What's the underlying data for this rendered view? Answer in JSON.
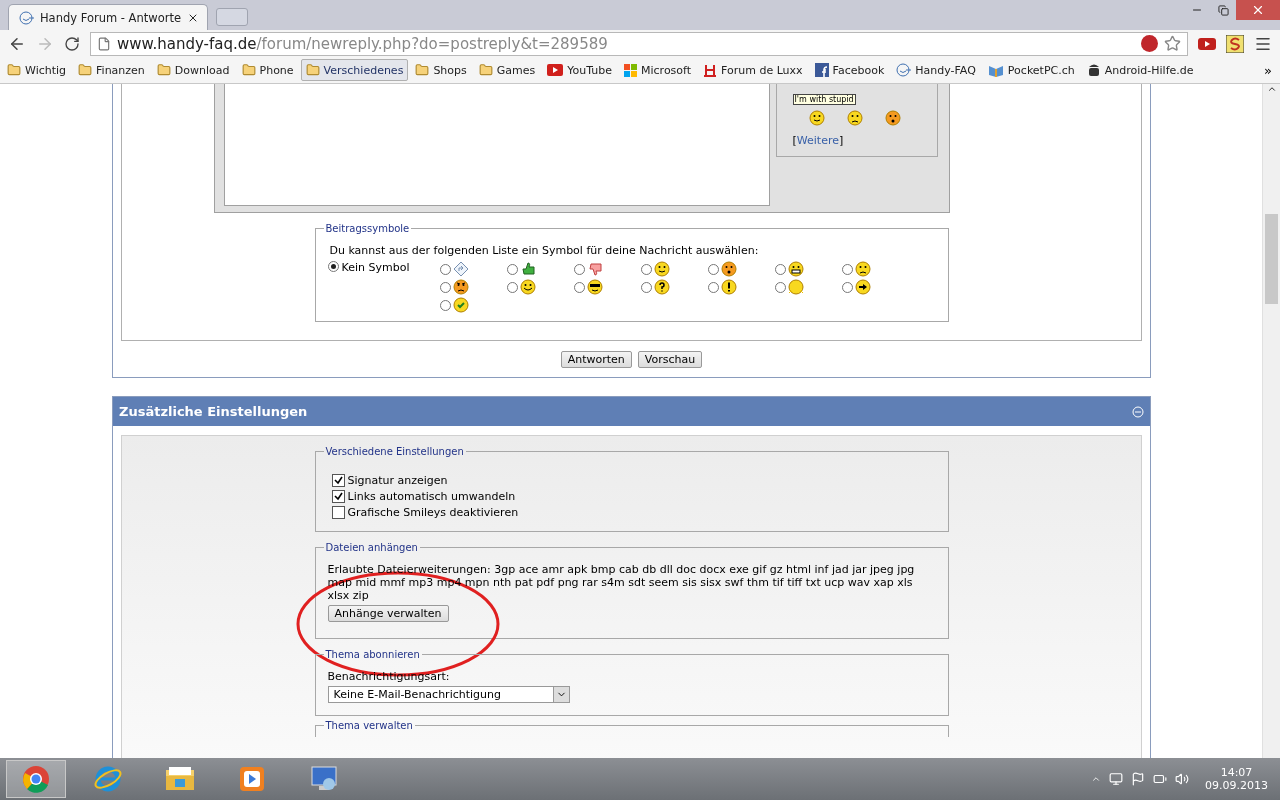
{
  "browser": {
    "tabs": [
      {
        "title": "Handy Forum - Antworte",
        "selected": true
      }
    ],
    "url": {
      "host": "www.handy-faq.de",
      "path": "/forum/newreply.php?do=postreply&t=289589"
    },
    "bookmarks": [
      {
        "label": "Wichtig",
        "kind": "folder",
        "selected": false
      },
      {
        "label": "Finanzen",
        "kind": "folder",
        "selected": false
      },
      {
        "label": "Download",
        "kind": "folder",
        "selected": false
      },
      {
        "label": "Phone",
        "kind": "folder",
        "selected": false
      },
      {
        "label": "Verschiedenes",
        "kind": "folder",
        "selected": true
      },
      {
        "label": "Shops",
        "kind": "folder",
        "selected": false
      },
      {
        "label": "Games",
        "kind": "folder",
        "selected": false
      },
      {
        "label": "YouTube",
        "kind": "video",
        "selected": false
      },
      {
        "label": "Microsoft",
        "kind": "windows",
        "selected": false
      },
      {
        "label": "Forum de Luxx",
        "kind": "letter-h",
        "selected": false
      },
      {
        "label": "Facebook",
        "kind": "letter-f",
        "selected": false
      },
      {
        "label": "Handy-FAQ",
        "kind": "smiley",
        "selected": false
      },
      {
        "label": "PocketPC.ch",
        "kind": "book",
        "selected": false
      },
      {
        "label": "Android-Hilfe.de",
        "kind": "robot",
        "selected": false
      }
    ],
    "more": "»"
  },
  "editor": {
    "tooltip": "I'm with stupid",
    "more_link": {
      "open": "[",
      "label": "Weitere",
      "close": "]"
    }
  },
  "post_icons": {
    "legend": "Beitragssymbole",
    "prompt": "Du kannst aus der folgenden Liste ein Symbol für deine Nachricht auswählen:",
    "none": {
      "label": "Kein Symbol",
      "selected": true
    },
    "options": [
      {
        "kind": "arrow-sign",
        "selected": false
      },
      {
        "kind": "thumb-up",
        "selected": false
      },
      {
        "kind": "thumb-down",
        "selected": false
      },
      {
        "kind": "smile",
        "selected": false
      },
      {
        "kind": "surprised",
        "selected": false
      },
      {
        "kind": "grin",
        "selected": false
      },
      {
        "kind": "frown",
        "selected": false
      },
      {
        "kind": "angry",
        "selected": false
      },
      {
        "kind": "happy",
        "selected": false
      },
      {
        "kind": "cool",
        "selected": false
      },
      {
        "kind": "question",
        "selected": false
      },
      {
        "kind": "exclamation",
        "selected": false
      },
      {
        "kind": "sun",
        "selected": false
      },
      {
        "kind": "arrow-right",
        "selected": false
      },
      {
        "kind": "check",
        "selected": false
      }
    ]
  },
  "buttons": [
    "Antworten",
    "Vorschau"
  ],
  "extra": {
    "title": "Zusätzliche Einstellungen",
    "expanded": true,
    "misc": {
      "legend": "Verschiedene Einstellungen",
      "options": [
        {
          "label": "Signatur anzeigen",
          "checked": true
        },
        {
          "label": "Links automatisch umwandeln",
          "checked": true
        },
        {
          "label": "Grafische Smileys deaktivieren",
          "checked": false
        }
      ]
    },
    "attachments": {
      "legend": "Dateien anhängen",
      "text": "Erlaubte Dateierweiterungen: 3gp ace amr apk bmp cab db dll doc docx exe gif gz html inf jad jar jpeg jpg map mid mmf mp3 mp4 mpn nth pat pdf png rar s4m sdt seem sis sisx swf thm tif tiff txt ucp wav xap xls xlsx zip",
      "button": "Anhänge verwalten"
    },
    "subscribe": {
      "legend": "Thema abonnieren",
      "label": "Benachrichtigungsart:",
      "value": "Keine E-Mail-Benachrichtigung"
    },
    "manage": {
      "legend": "Thema verwalten"
    }
  },
  "taskbar": {
    "apps": [
      {
        "kind": "chrome",
        "selected": true
      },
      {
        "kind": "ie",
        "selected": false
      },
      {
        "kind": "explorer",
        "selected": false
      },
      {
        "kind": "media",
        "selected": false
      },
      {
        "kind": "remote",
        "selected": false
      }
    ],
    "time": "14:07",
    "date": "09.09.2013"
  }
}
